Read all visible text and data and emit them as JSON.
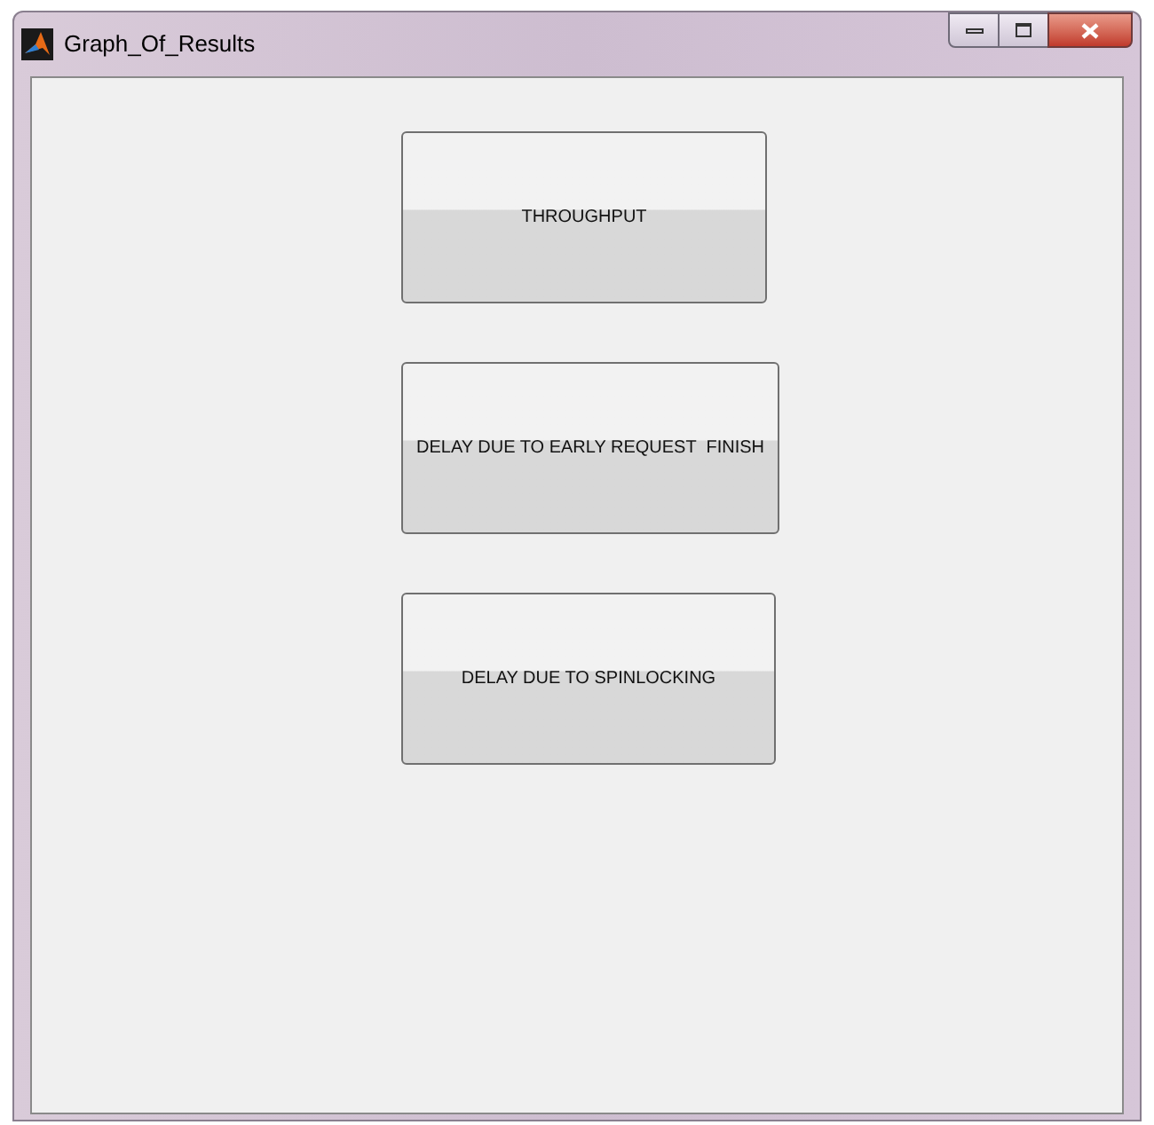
{
  "window": {
    "title": "Graph_Of_Results"
  },
  "buttons": [
    {
      "label": "THROUGHPUT"
    },
    {
      "label": "DELAY DUE TO EARLY REQUEST  FINISH"
    },
    {
      "label": "DELAY DUE TO SPINLOCKING"
    }
  ]
}
